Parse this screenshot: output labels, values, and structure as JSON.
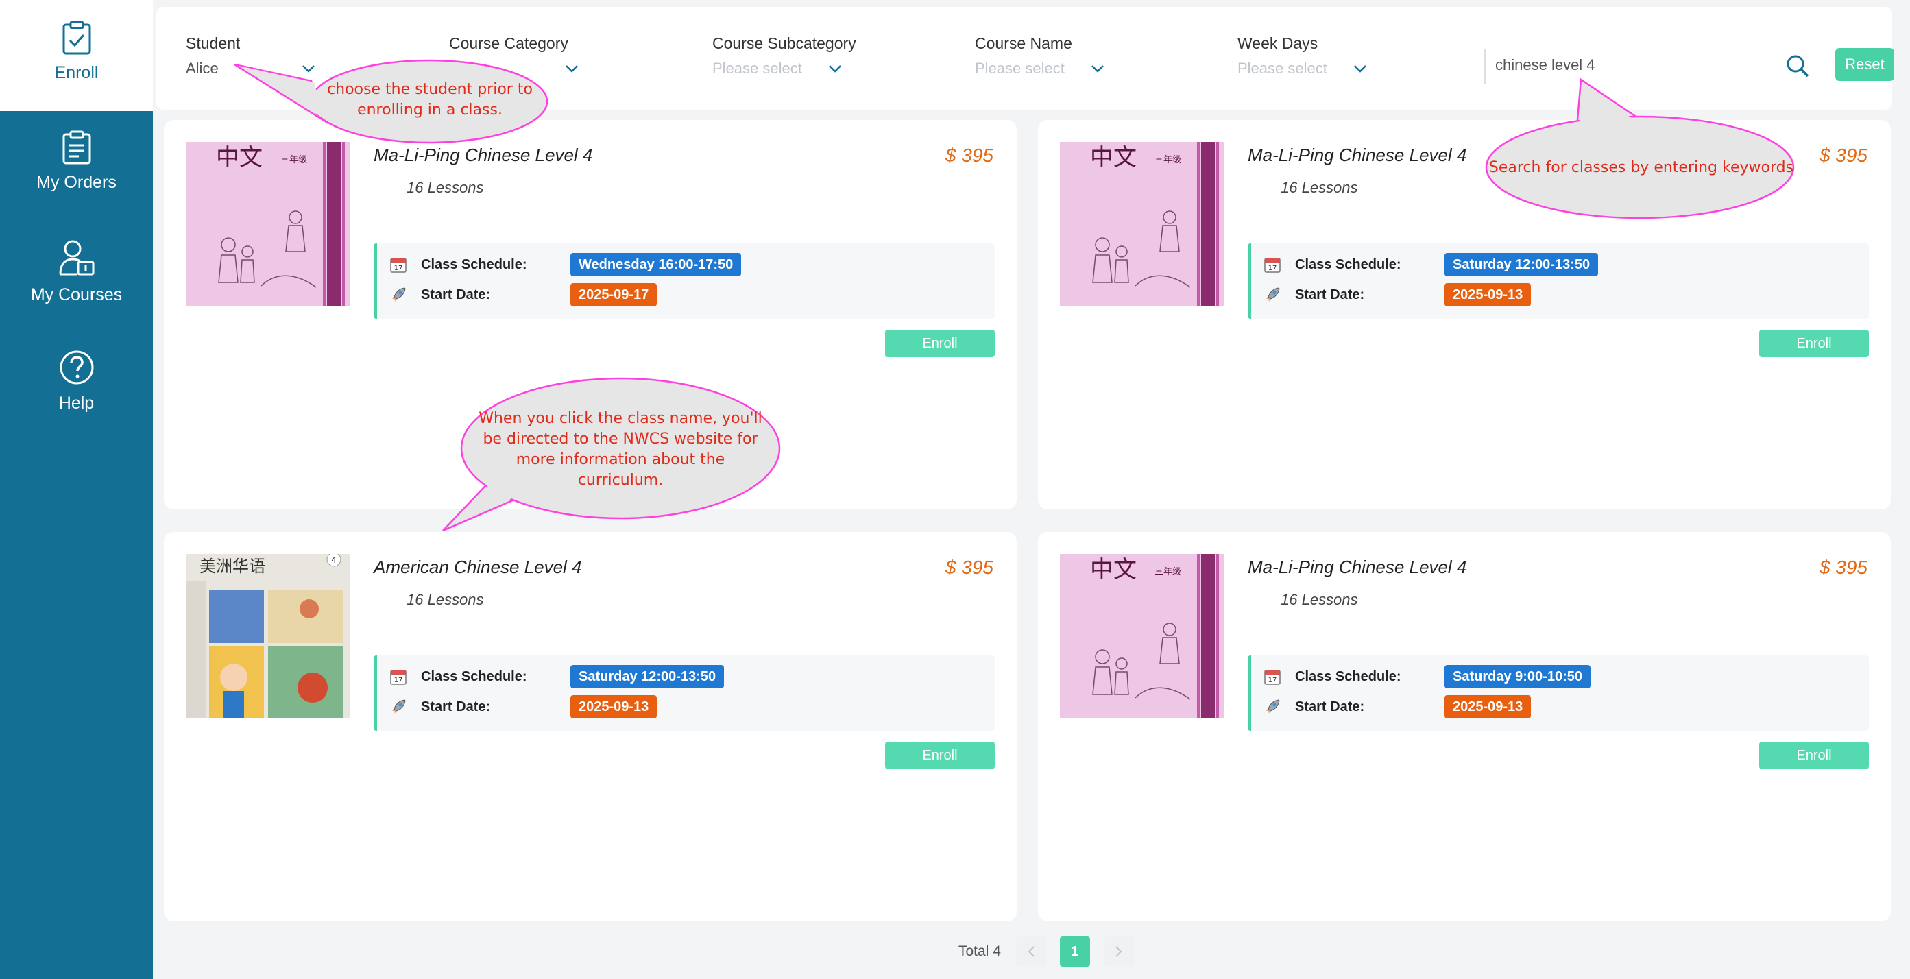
{
  "sidebar": {
    "items": [
      {
        "label": "Enroll",
        "icon": "clipboard-check-icon",
        "active": true
      },
      {
        "label": "My Orders",
        "icon": "clipboard-list-icon",
        "active": false
      },
      {
        "label": "My Courses",
        "icon": "user-book-icon",
        "active": false
      },
      {
        "label": "Help",
        "icon": "question-circle-icon",
        "active": false
      }
    ]
  },
  "filters": {
    "student": {
      "label": "Student",
      "value": "Alice"
    },
    "course_category": {
      "label": "Course Category",
      "value": ""
    },
    "course_subcategory": {
      "label": "Course Subcategory",
      "placeholder": "Please select"
    },
    "course_name": {
      "label": "Course Name",
      "placeholder": "Please select"
    },
    "week_days": {
      "label": "Week Days",
      "placeholder": "Please select"
    },
    "search": {
      "value": "chinese level 4"
    },
    "reset_label": "Reset"
  },
  "schedule_labels": {
    "schedule": "Class Schedule:",
    "start": "Start Date:"
  },
  "enroll_label": "Enroll",
  "courses": [
    {
      "name": "Ma-Li-Ping Chinese Level 4",
      "lessons": "16 Lessons",
      "price": "$ 395",
      "schedule": "Wednesday 16:00-17:50",
      "start_date": "2025-09-17",
      "book": "ma-li-ping",
      "cover_title": "中文",
      "cover_grade": "三年级"
    },
    {
      "name": "Ma-Li-Ping Chinese Level 4",
      "lessons": "16 Lessons",
      "price": "$ 395",
      "schedule": "Saturday 12:00-13:50",
      "start_date": "2025-09-13",
      "book": "ma-li-ping",
      "cover_title": "中文",
      "cover_grade": "三年级"
    },
    {
      "name": "American Chinese Level 4",
      "lessons": "16 Lessons",
      "price": "$ 395",
      "schedule": "Saturday 12:00-13:50",
      "start_date": "2025-09-13",
      "book": "american-chinese",
      "cover_title": "美洲华语",
      "cover_grade": "4"
    },
    {
      "name": "Ma-Li-Ping Chinese Level 4",
      "lessons": "16 Lessons",
      "price": "$ 395",
      "schedule": "Saturday 9:00-10:50",
      "start_date": "2025-09-13",
      "book": "ma-li-ping",
      "cover_title": "中文",
      "cover_grade": "三年级"
    }
  ],
  "pagination": {
    "total": "Total 4",
    "current": "1"
  },
  "callouts": {
    "student": "choose the student prior to enrolling in a class.",
    "search": "Search for classes by entering  keywords",
    "class_name": "When you click the class name, you'll be directed to the NWCS website for more information about the curriculum."
  },
  "colors": {
    "sidebar": "#136f94",
    "accent": "#48d1a5",
    "price": "#e06a15",
    "schedule_badge": "#1f78d1",
    "date_badge": "#e8600f",
    "callout_border": "#ff40e0",
    "callout_text": "#e02b1a"
  }
}
